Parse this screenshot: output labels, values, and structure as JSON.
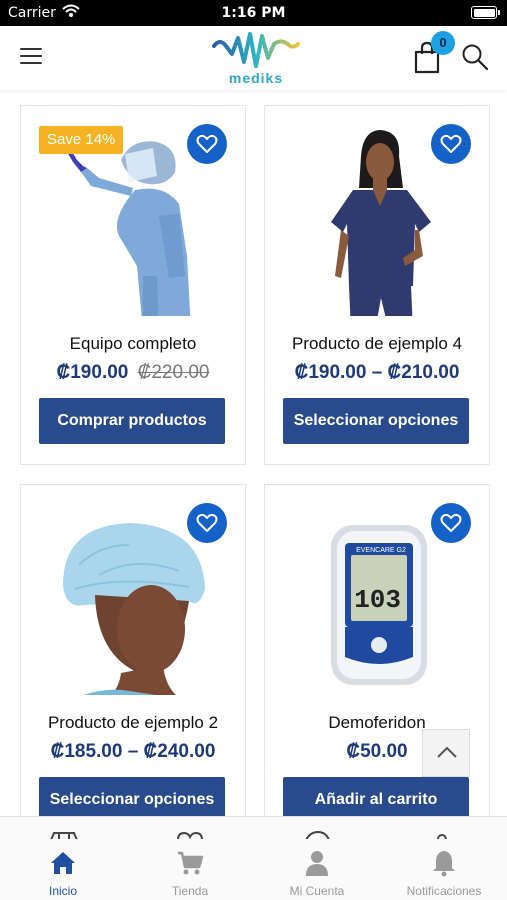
{
  "status_bar": {
    "carrier": "Carrier",
    "time": "1:16 PM"
  },
  "header": {
    "logo_text": "mediks",
    "cart_count": "0"
  },
  "products": [
    {
      "title": "Equipo completo",
      "price": "₡190.00",
      "old_price": "₡220.00",
      "sale_badge": "Save 14%",
      "button": "Comprar productos"
    },
    {
      "title": "Producto de ejemplo 4",
      "price": "₡190.00 – ₡210.00",
      "button": "Seleccionar opciones"
    },
    {
      "title": "Producto de ejemplo 2",
      "price": "₡185.00 – ₡240.00",
      "button": "Seleccionar opciones"
    },
    {
      "title": "Demoferidon",
      "price": "₡50.00",
      "button": "Añadir al carrito",
      "device_brand": "EVENCARE G2",
      "device_reading": "103"
    }
  ],
  "tabs": [
    {
      "label": "Inicio",
      "icon": "home-icon",
      "active": true
    },
    {
      "label": "Tienda",
      "icon": "cart-icon",
      "active": false
    },
    {
      "label": "Mi Cuenta",
      "icon": "user-icon",
      "active": false
    },
    {
      "label": "Notificaciones",
      "icon": "bell-icon",
      "active": false
    }
  ],
  "colors": {
    "primary": "#2a4a8e",
    "accent": "#1461c8",
    "badge": "#f5b324",
    "price": "#1e3a7a",
    "active_tab": "#1f4fa0"
  }
}
